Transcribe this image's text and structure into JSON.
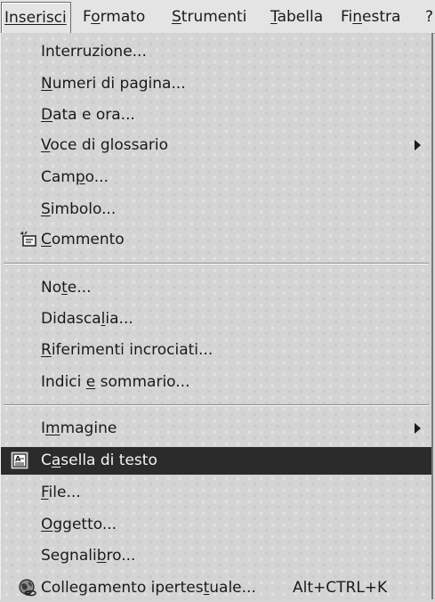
{
  "menubar": {
    "items": [
      {
        "label": "Inserisci",
        "mnemonic_index": 0
      },
      {
        "label": "Formato",
        "mnemonic_index": 1
      },
      {
        "label": "Strumenti",
        "mnemonic_index": 0
      },
      {
        "label": "Tabella",
        "mnemonic_index": 0
      },
      {
        "label": "Finestra",
        "mnemonic_index": 2
      },
      {
        "label": "?",
        "mnemonic_index": -1
      }
    ]
  },
  "menu": {
    "items": [
      {
        "label": "Interruzione...",
        "mnemonic_index": -1,
        "submenu": false
      },
      {
        "label": "Numeri di pagina...",
        "mnemonic_index": 0,
        "submenu": false
      },
      {
        "label": "Data e ora...",
        "mnemonic_index": 0,
        "submenu": false
      },
      {
        "label": "Voce di glossario",
        "mnemonic_index": 0,
        "submenu": true
      },
      {
        "label": "Campo...",
        "mnemonic_index": 3,
        "submenu": false
      },
      {
        "label": "Simbolo...",
        "mnemonic_index": 0,
        "submenu": false
      },
      {
        "label": "Commento",
        "mnemonic_index": 0,
        "submenu": false,
        "icon": "comment-icon"
      },
      {
        "label": "Note...",
        "mnemonic_index": 2,
        "submenu": false
      },
      {
        "label": "Didascalia...",
        "mnemonic_index": 7,
        "submenu": false
      },
      {
        "label": "Riferimenti incrociati...",
        "mnemonic_index": 0,
        "submenu": false
      },
      {
        "label": "Indici e sommario...",
        "mnemonic_index": 7,
        "submenu": false
      },
      {
        "label": "Immagine",
        "mnemonic_index": 1,
        "submenu": true
      },
      {
        "label": "Casella di testo",
        "mnemonic_index": 1,
        "submenu": false,
        "icon": "text-box-icon",
        "selected": true
      },
      {
        "label": "File...",
        "mnemonic_index": 0,
        "submenu": false
      },
      {
        "label": "Oggetto...",
        "mnemonic_index": 0,
        "submenu": false
      },
      {
        "label": "Segnalibro...",
        "mnemonic_index": 7,
        "submenu": false
      },
      {
        "label": "Collegamento ipertestuale...",
        "mnemonic_index": 20,
        "submenu": false,
        "icon": "hyperlink-globe-icon",
        "shortcut": "Alt+CTRL+K"
      }
    ]
  },
  "colors": {
    "menu_background": "#d4d4d4",
    "selection_background": "#2b2b2b",
    "selection_text": "#f4f4f4",
    "text": "#1a1a1a"
  }
}
